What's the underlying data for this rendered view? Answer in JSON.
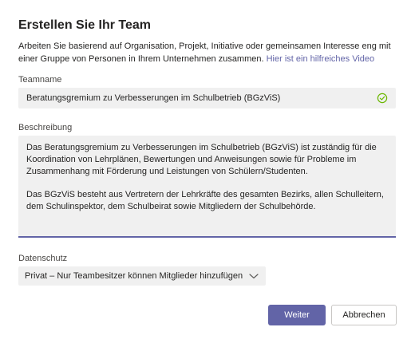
{
  "dialog": {
    "title": "Erstellen Sie Ihr Team",
    "intro_text": "Arbeiten Sie basierend auf Organisation, Projekt, Initiative oder gemeinsamen Interesse eng mit einer Gruppe von Personen in Ihrem Unternehmen zusammen. ",
    "intro_link": "Hier ist ein hilfreiches Video"
  },
  "team_name": {
    "label": "Teamname",
    "value": "Beratungsgremium zu Verbesserungen im Schulbetrieb (BGzViS)",
    "status_icon": "check-circle-icon"
  },
  "description": {
    "label": "Beschreibung",
    "paragraph_1": "Das Beratungsgremium zu Verbesserungen im Schulbetrieb (BGzViS) ist zuständig für die Koordination von Lehrplänen, Bewertungen und Anweisungen sowie für Probleme im Zusammenhang mit Förderung und Leistungen von Schülern/Studenten.",
    "paragraph_2": "Das BGzViS besteht aus Vertretern der Lehrkräfte des gesamten Bezirks, allen Schulleitern, dem Schulinspektor, dem Schulbeirat sowie Mitgliedern der Schulbehörde."
  },
  "privacy": {
    "label": "Datenschutz",
    "selected": "Privat – Nur Teambesitzer können Mitglieder hinzufügen",
    "icon": "chevron-down-icon"
  },
  "buttons": {
    "next_label": "Weiter",
    "cancel_label": "Abbrechen"
  },
  "colors": {
    "accent": "#6264a7",
    "success": "#6bb700",
    "field_bg": "#f0f0f0"
  }
}
